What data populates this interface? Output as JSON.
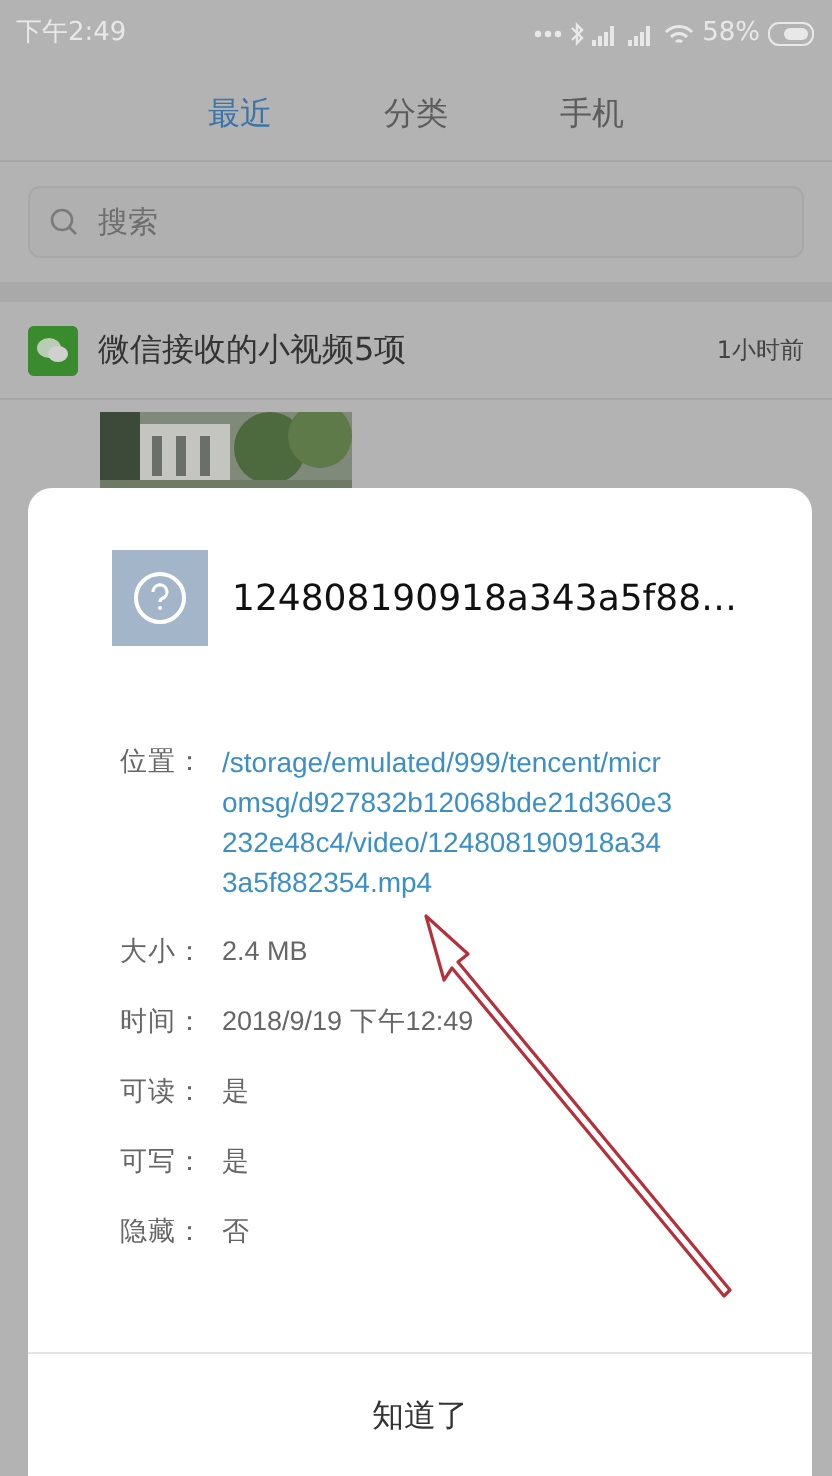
{
  "status_bar": {
    "time": "下午2:49",
    "battery": "58%"
  },
  "tabs": [
    {
      "label": "最近",
      "selected": true
    },
    {
      "label": "分类",
      "selected": false
    },
    {
      "label": "手机",
      "selected": false
    }
  ],
  "search": {
    "placeholder": "搜索"
  },
  "group": {
    "title": "微信接收的小视频5项",
    "time": "1小时前"
  },
  "dialog": {
    "file_name": "124808190918a343a5f88…",
    "details": [
      {
        "label": "位置：",
        "value": "/storage/emulated/999/tencent/micromsg/d927832b12068bde21d360e3232e48c4/video/124808190918a343a5f882354.mp4",
        "kind": "link"
      },
      {
        "label": "大小：",
        "value": "2.4 MB",
        "kind": "text"
      },
      {
        "label": "时间：",
        "value": "2018/9/19 下午12:49",
        "kind": "text"
      },
      {
        "label": "可读：",
        "value": "是",
        "kind": "text"
      },
      {
        "label": "可写：",
        "value": "是",
        "kind": "text"
      },
      {
        "label": "隐藏：",
        "value": "否",
        "kind": "text"
      }
    ],
    "button": "知道了"
  }
}
